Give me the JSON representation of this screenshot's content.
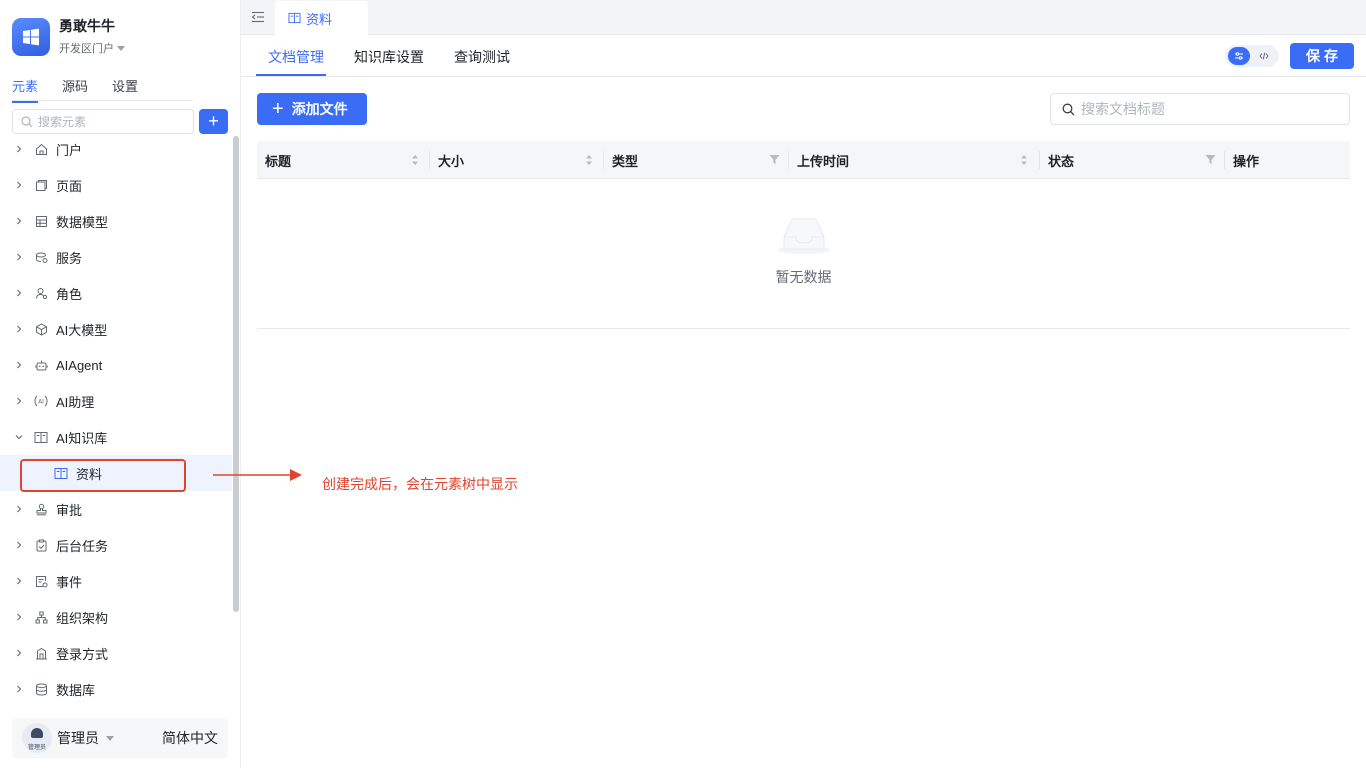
{
  "app": {
    "name": "勇敢牛牛",
    "portal": "开发区门户"
  },
  "sidebar": {
    "tabs": [
      {
        "label": "元素",
        "active": true
      },
      {
        "label": "源码",
        "active": false
      },
      {
        "label": "设置",
        "active": false
      }
    ],
    "search_placeholder": "搜索元素",
    "add_label": "+",
    "tree": [
      {
        "label": "门户",
        "icon": "home-icon",
        "expanded": false
      },
      {
        "label": "页面",
        "icon": "page-icon",
        "expanded": false
      },
      {
        "label": "数据模型",
        "icon": "table-icon",
        "expanded": false
      },
      {
        "label": "服务",
        "icon": "service-icon",
        "expanded": false
      },
      {
        "label": "角色",
        "icon": "role-icon",
        "expanded": false
      },
      {
        "label": "AI大模型",
        "icon": "cube-icon",
        "expanded": false
      },
      {
        "label": "AIAgent",
        "icon": "robot-icon",
        "expanded": false
      },
      {
        "label": "AI助理",
        "icon": "ai-assistant-icon",
        "expanded": false
      },
      {
        "label": "AI知识库",
        "icon": "book-icon",
        "expanded": true
      },
      {
        "label": "资料",
        "icon": "book-icon",
        "child": true,
        "selected": true
      },
      {
        "label": "审批",
        "icon": "stamp-icon",
        "expanded": false
      },
      {
        "label": "后台任务",
        "icon": "task-icon",
        "expanded": false
      },
      {
        "label": "事件",
        "icon": "event-icon",
        "expanded": false
      },
      {
        "label": "组织架构",
        "icon": "org-icon",
        "expanded": false
      },
      {
        "label": "登录方式",
        "icon": "login-icon",
        "expanded": false
      },
      {
        "label": "数据库",
        "icon": "database-icon",
        "expanded": false
      }
    ],
    "user": {
      "avatar_tag": "管理员",
      "name": "管理员",
      "language": "简体中文"
    }
  },
  "topbar": {
    "open_tab": "资料"
  },
  "subtabs": [
    {
      "label": "文档管理",
      "active": true
    },
    {
      "label": "知识库设置",
      "active": false
    },
    {
      "label": "查询测试",
      "active": false
    }
  ],
  "toolbar": {
    "save_label": "保存",
    "mode_on_icon": "settings-sliders-icon",
    "mode_off_icon": "code-icon"
  },
  "main": {
    "add_file_label": "添加文件",
    "search_placeholder": "搜索文档标题",
    "table": {
      "columns": [
        {
          "label": "标题",
          "control": "sort"
        },
        {
          "label": "大小",
          "control": "sort"
        },
        {
          "label": "类型",
          "control": "filter"
        },
        {
          "label": "上传时间",
          "control": "sort"
        },
        {
          "label": "状态",
          "control": "filter"
        },
        {
          "label": "操作",
          "control": "none"
        }
      ],
      "rows": [],
      "empty_text": "暂无数据"
    }
  },
  "annotation": {
    "text": "创建完成后，会在元素树中显示",
    "color": "#e0442e"
  },
  "colors": {
    "accent": "#3b6cf6",
    "annotation": "#e0442e"
  }
}
